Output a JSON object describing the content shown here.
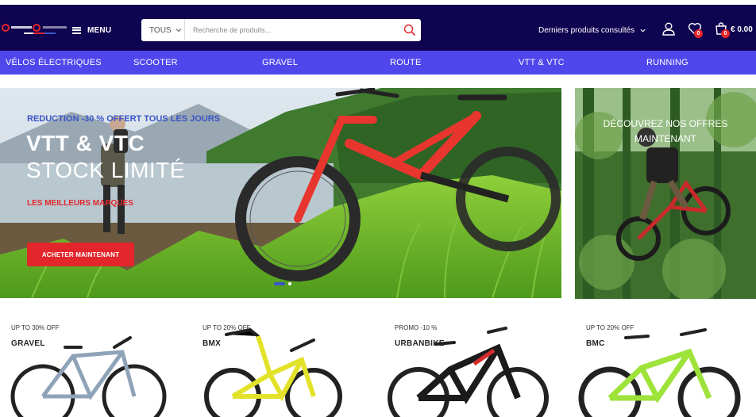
{
  "header": {
    "menu_label": "MENU",
    "search": {
      "category": "TOUS",
      "placeholder": "Recherche de produits..."
    },
    "recent_label": "Derniers produits consultés",
    "wishlist_count": "0",
    "cart_count": "0",
    "cart_total": "€ 0.00"
  },
  "categories": [
    "VÉLOS ÉLECTRIQUES",
    "SCOOTER",
    "GRAVEL",
    "ROUTE",
    "VTT & VTC",
    "RUNNING"
  ],
  "hero": {
    "promo": "REDUCTION -30 % OFFERT TOUS LES JOURS",
    "title_line1": "VTT & VTC",
    "title_line2": "STOCK LIMITÉ",
    "subtitle": "LES MEILLEURS MARQUES",
    "cta": "ACHETER MAINTENANT",
    "slides": 2,
    "active_slide": 1
  },
  "side_banner": {
    "text_line1": "DÉCOUVREZ NOS OFFRES",
    "text_line2": "MAINTENANT"
  },
  "products": [
    {
      "tag": "UP TO 30% OFF",
      "name": "GRAVEL"
    },
    {
      "tag": "UP TO 20% OFF",
      "name": "BMX"
    },
    {
      "tag": "PROMO -10 %",
      "name": "URBANBIKE"
    },
    {
      "tag": "UP TO 20% OFF",
      "name": "BMC"
    }
  ],
  "colors": {
    "header_bg": "#0f0450",
    "nav_bg": "#4f47ec",
    "accent_red": "#e3262b",
    "promo_blue": "#3a55c8"
  }
}
